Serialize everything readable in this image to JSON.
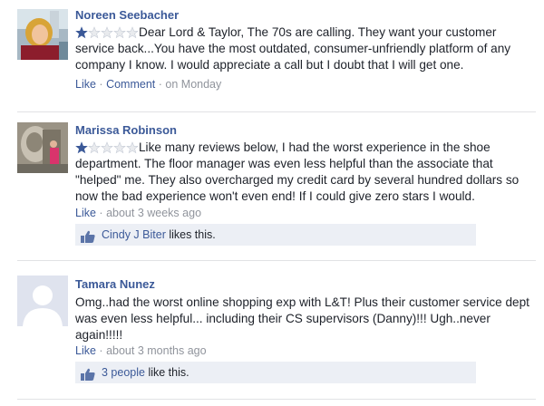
{
  "colors": {
    "link": "#3b5998",
    "meta": "#90949c",
    "star_filled": "#3b5998",
    "star_empty": "#e9ebee",
    "likebox_bg": "#eceff5"
  },
  "reviews": [
    {
      "name": "Noreen Seebacher",
      "rating": 1,
      "rating_max": 5,
      "text": "Dear Lord & Taylor, The 70s are calling. They want your customer service back...You have the most outdated, consumer-unfriendly platform of any company I know. I would appreciate a call but I doubt that I will get one.",
      "like_label": "Like",
      "sep": "·",
      "comment_label": "Comment",
      "time": "on Monday"
    },
    {
      "name": "Marissa Robinson",
      "rating": 1,
      "rating_max": 5,
      "text": "Like many reviews below, I had the worst experience in the shoe department. The floor manager was even less helpful than the associate that \"helped\" me. They also overcharged my credit card by several hundred dollars so now the bad experience won't even end! If I could give zero stars I would.",
      "like_label": "Like",
      "sep": "·",
      "time": "about 3 weeks ago",
      "likes": {
        "who": "Cindy J Biter",
        "suffix": " likes this."
      }
    },
    {
      "name": "Tamara Nunez",
      "text": "Omg..had the worst online shopping exp with L&T! Plus their customer service dept was even less helpful... including their CS supervisors (Danny)!!! Ugh..never again!!!!!",
      "like_label": "Like",
      "sep": "·",
      "time": "about 3 months ago",
      "likes": {
        "who": "3 people",
        "suffix": " like this."
      }
    }
  ]
}
